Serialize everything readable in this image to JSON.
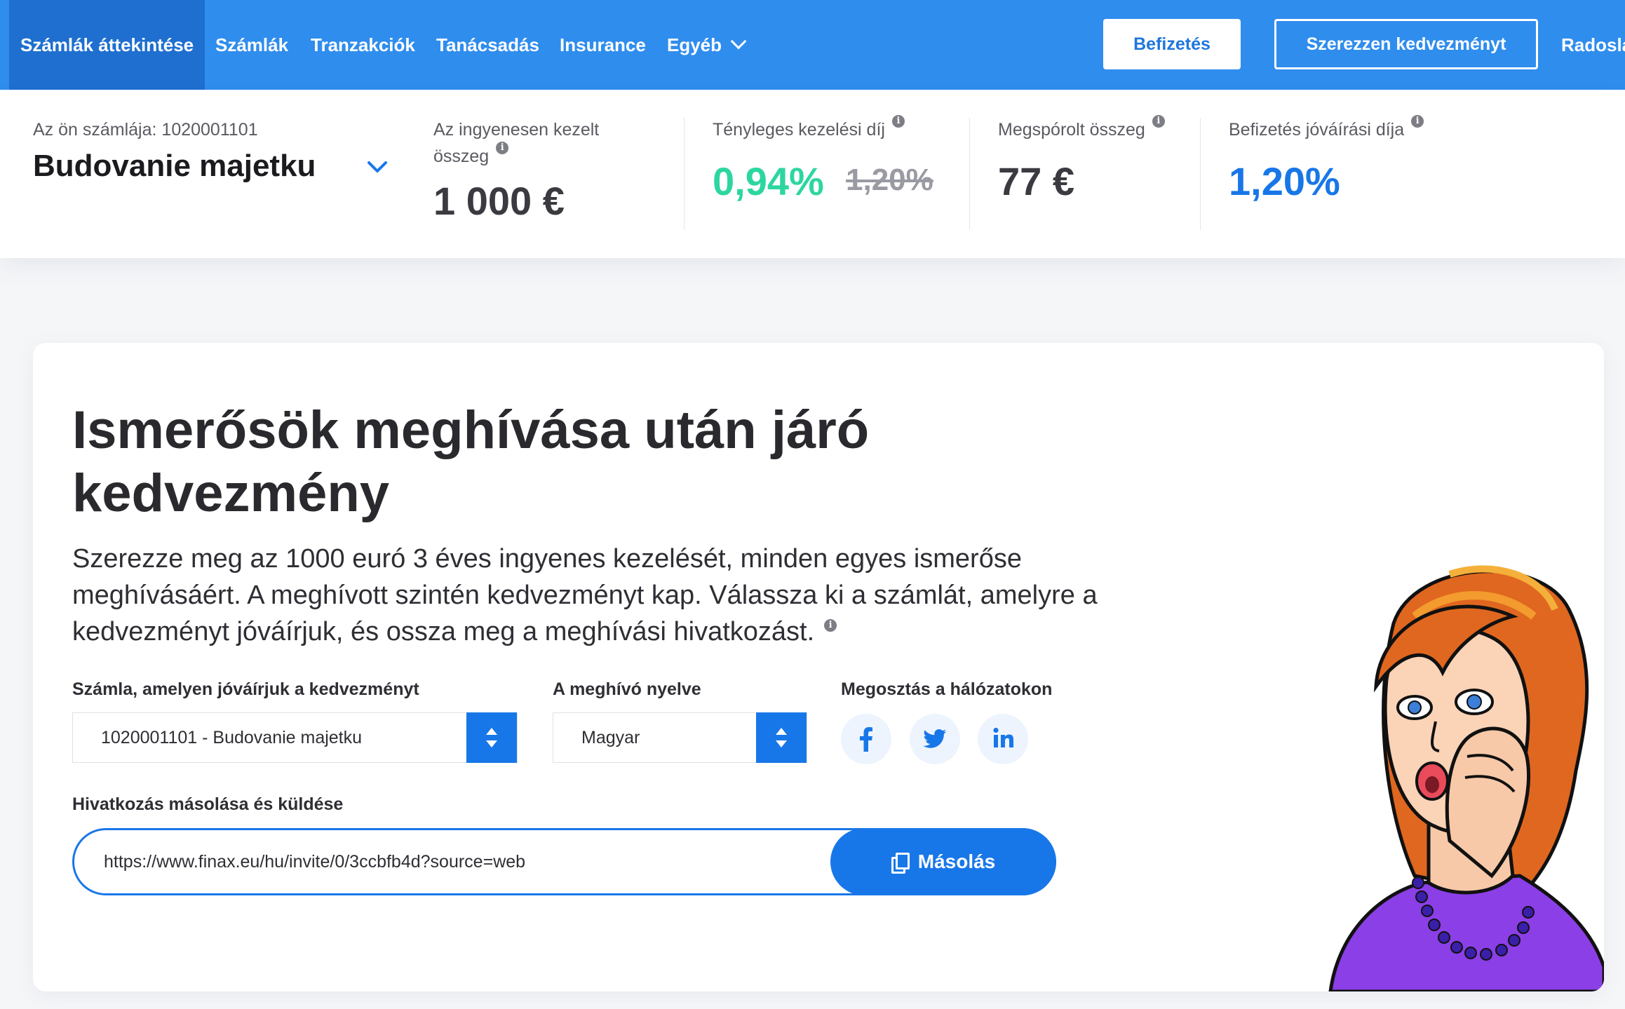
{
  "nav": {
    "items": [
      {
        "label": "Számlák áttekintése",
        "active": true
      },
      {
        "label": "Számlák"
      },
      {
        "label": "Tranzakciók"
      },
      {
        "label": "Tanácsadás"
      },
      {
        "label": "Insurance"
      },
      {
        "label": "Egyéb"
      }
    ],
    "deposit_button": "Befizetés",
    "discount_button": "Szerezzen kedvezményt",
    "user_name": "Radosla"
  },
  "account": {
    "label": "Az ön számlája: 1020001101",
    "name": "Budovanie majetku"
  },
  "stats": {
    "free_managed": {
      "label": "Az ingyenesen kezelt összeg",
      "value": "1 000 €"
    },
    "actual_fee": {
      "label": "Tényleges kezelési díj",
      "value": "0,94%",
      "old_value": "1,20%"
    },
    "saved": {
      "label": "Megspórolt összeg",
      "value": "77 €"
    },
    "deposit_fee": {
      "label": "Befizetés jóváírási díja",
      "value": "1,20%"
    }
  },
  "colors": {
    "nav_bg": "#2f8ded",
    "accent": "#1877e8",
    "green": "#2dd6a0"
  },
  "referral": {
    "title": "Ismerősök meghívása után járó kedvezmény",
    "description": "Szerezze meg az 1000 euró 3 éves ingyenes kezelését, minden egyes ismerőse meghívásáért. A meghívott szintén kedvezményt kap. Válassza ki a számlát, amelyre a kedvezményt jóváírjuk, és ossza meg a meghívási hivatkozást.",
    "account_select_label": "Számla, amelyen jóváírjuk a kedvezményt",
    "account_select_value": "1020001101 - Budovanie majetku",
    "language_label": "A meghívó nyelve",
    "language_value": "Magyar",
    "share_label": "Megosztás a hálózatokon",
    "social_icons": [
      "facebook-icon",
      "twitter-icon",
      "linkedin-icon"
    ],
    "link_label": "Hivatkozás másolása és küldése",
    "link_value": "https://www.finax.eu/hu/invite/0/3ccbfb4d?source=web",
    "copy_button": "Másolás"
  }
}
